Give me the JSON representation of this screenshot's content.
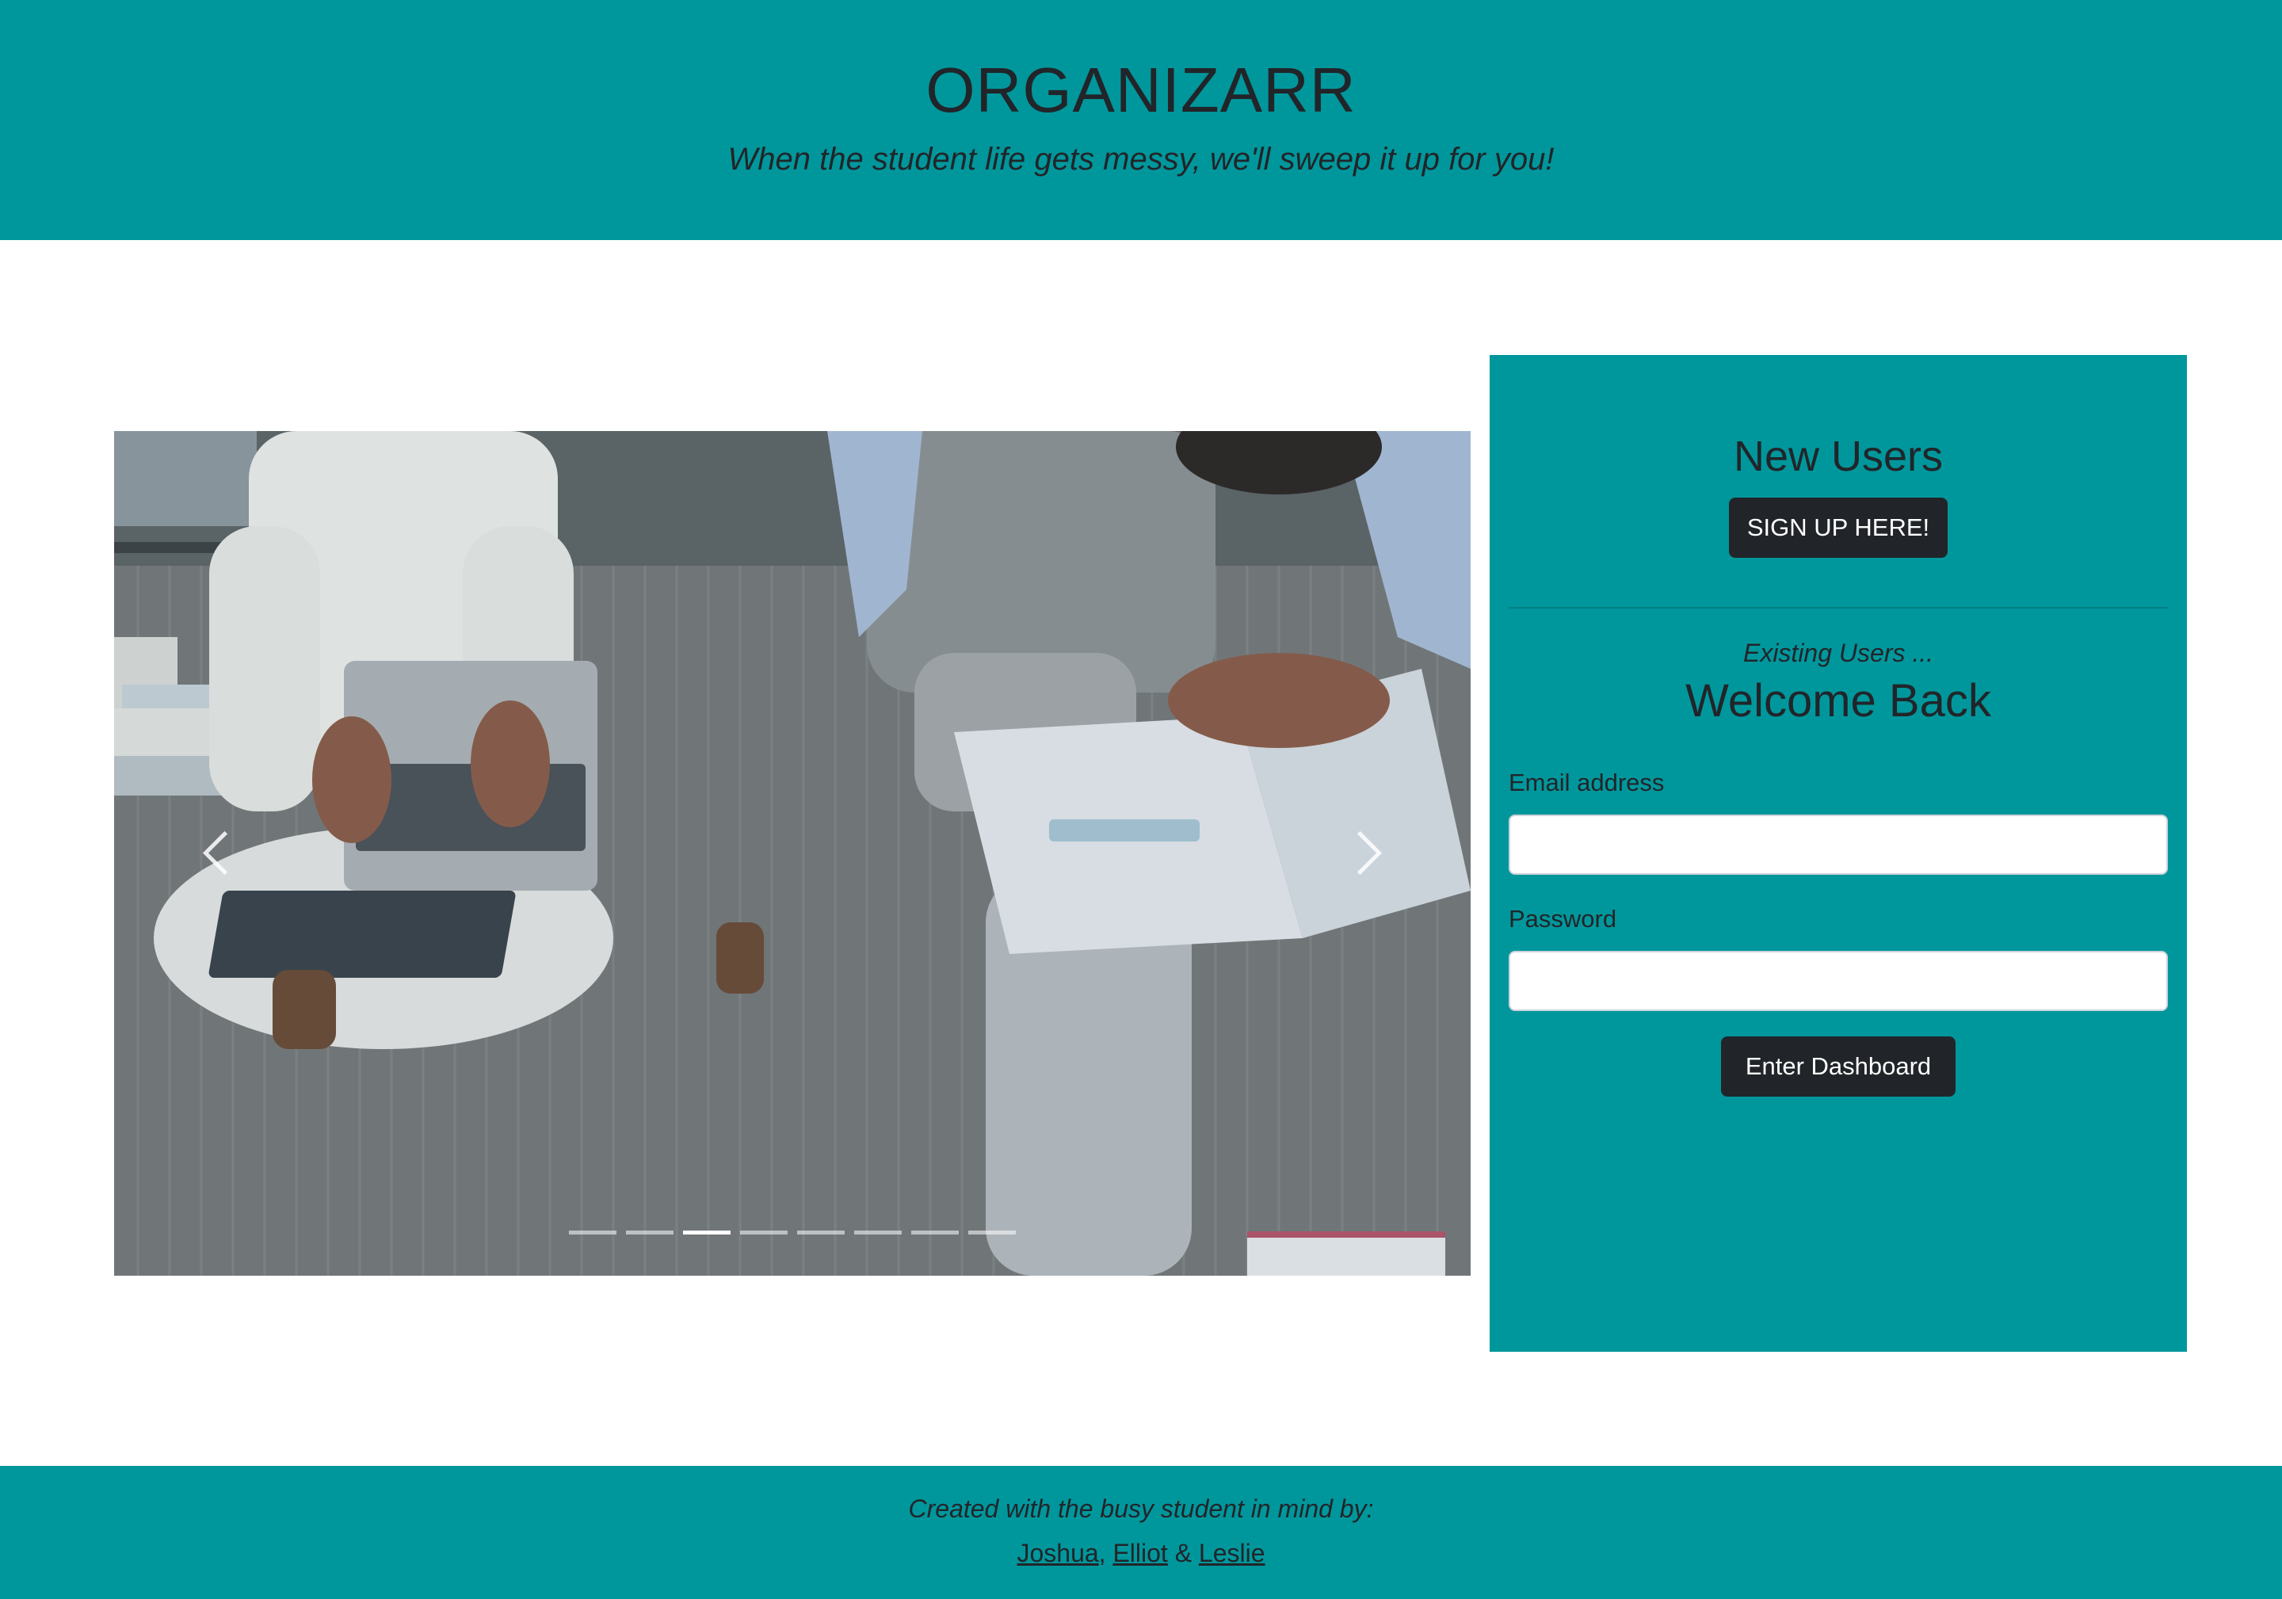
{
  "header": {
    "title": "ORGANIZARR",
    "tagline": "When the student life gets messy, we'll sweep it up for you!"
  },
  "carousel": {
    "image_description": "Two students sitting on a carpeted floor, one typing on a laptop and one reading a textbook",
    "indicators": [
      {
        "active": false
      },
      {
        "active": false
      },
      {
        "active": true
      },
      {
        "active": false
      },
      {
        "active": false
      },
      {
        "active": false
      },
      {
        "active": false
      },
      {
        "active": false
      }
    ]
  },
  "panel": {
    "new_users_title": "New Users",
    "signup_button": "SIGN UP HERE!",
    "existing_label": "Existing Users ...",
    "welcome_title": "Welcome Back",
    "email_label": "Email address",
    "email_value": "",
    "password_label": "Password",
    "password_value": "",
    "enter_button": "Enter Dashboard"
  },
  "footer": {
    "credit": "Created with the busy student in mind by:",
    "authors": [
      "Joshua",
      "Elliot",
      "Leslie"
    ],
    "sep1": ", ",
    "sep2": " & "
  },
  "colors": {
    "brand_teal": "#00979c",
    "dark_button": "#212529",
    "text": "#212529"
  }
}
